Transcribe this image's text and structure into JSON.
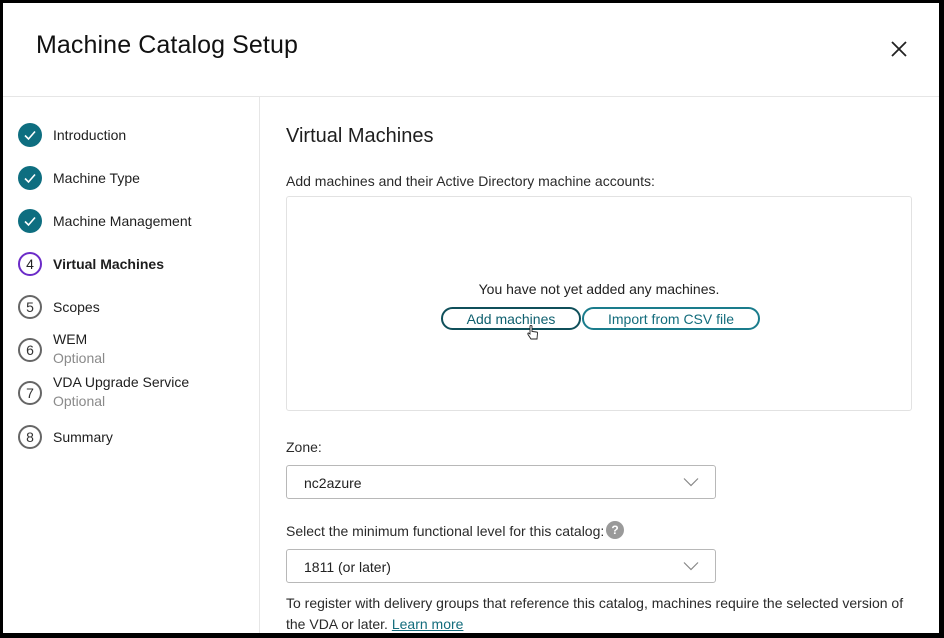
{
  "dialog": {
    "title": "Machine Catalog Setup",
    "close_icon": "close-icon"
  },
  "steps": [
    {
      "number": "1",
      "label": "Introduction",
      "status": "completed",
      "icon": "check-icon"
    },
    {
      "number": "2",
      "label": "Machine Type",
      "status": "completed",
      "icon": "check-icon"
    },
    {
      "number": "3",
      "label": "Machine Management",
      "status": "completed",
      "icon": "check-icon"
    },
    {
      "number": "4",
      "label": "Virtual Machines",
      "status": "current"
    },
    {
      "number": "5",
      "label": "Scopes",
      "status": "pending"
    },
    {
      "number": "6",
      "label": "WEM",
      "sublabel": "Optional",
      "status": "pending"
    },
    {
      "number": "7",
      "label": "VDA Upgrade Service",
      "sublabel": "Optional",
      "status": "pending"
    },
    {
      "number": "8",
      "label": "Summary",
      "status": "pending"
    }
  ],
  "main": {
    "heading": "Virtual Machines",
    "description": "Add machines and their Active Directory machine accounts:",
    "empty_message": "You have not yet added any machines.",
    "add_button": "Add machines",
    "import_button": "Import from CSV file",
    "zone_label": "Zone:",
    "zone_value": "nc2azure",
    "level_label": "Select the minimum functional level for this catalog:",
    "level_value": "1811 (or later)",
    "note_text": "To register with delivery groups that reference this catalog, machines require the selected version of the VDA or later. ",
    "learn_more": "Learn more",
    "help_glyph": "?"
  },
  "colors": {
    "completed": "#0e6e80",
    "current": "#6b2bc8",
    "accent": "#136c7c"
  }
}
